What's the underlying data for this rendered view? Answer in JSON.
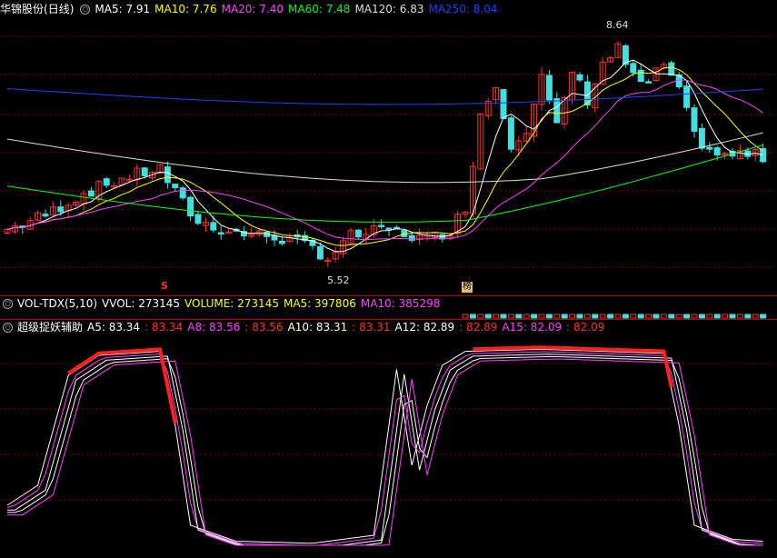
{
  "main": {
    "stock_name": "华锦股份",
    "period": "(日线)",
    "ma": [
      {
        "label": "MA5: 7.91",
        "color": "#ffffff"
      },
      {
        "label": "MA10: 7.76",
        "color": "#ffff00"
      },
      {
        "label": "MA20: 7.40",
        "color": "#ff40ff"
      },
      {
        "label": "MA60: 7.48",
        "color": "#00ff00"
      },
      {
        "label": "MA120: 6.83",
        "color": "#dddddd"
      },
      {
        "label": "MA250: 8.04",
        "color": "#2040ff"
      }
    ],
    "high_label": "8.64",
    "low_label": "5.52",
    "marker_s": "S",
    "marker_bang": "榜"
  },
  "volume": {
    "title": "VOL-TDX(5,10)",
    "items": [
      {
        "label": "VVOL: 273145",
        "color": "#ffffff"
      },
      {
        "label": "VOLUME: 273145",
        "color": "#ffff00"
      },
      {
        "label": "MA5: 397806",
        "color": "#ffff00"
      },
      {
        "label": "MA10: 385298",
        "color": "#ff40ff"
      }
    ]
  },
  "indicator": {
    "title": "超级捉妖辅助",
    "items": [
      {
        "label": "A5: 83.34",
        "color": "#ffffff"
      },
      {
        "label": ": 83.34",
        "color": "#ff3030"
      },
      {
        "label": "A8: 83.56",
        "color": "#ff40ff"
      },
      {
        "label": ": 83.56",
        "color": "#ff3030"
      },
      {
        "label": "A10: 83.31",
        "color": "#ffffff"
      },
      {
        "label": ": 83.31",
        "color": "#ff3030"
      },
      {
        "label": "A12: 82.89",
        "color": "#ffffff"
      },
      {
        "label": ": 82.89",
        "color": "#ff3030"
      },
      {
        "label": "A15: 82.09",
        "color": "#ff40ff"
      },
      {
        "label": ": 82.09",
        "color": "#ff3030"
      }
    ]
  },
  "colors": {
    "up": "#ff3030",
    "down": "#40e0e0",
    "grid": "#8b0000",
    "separator": "#b00000"
  }
}
